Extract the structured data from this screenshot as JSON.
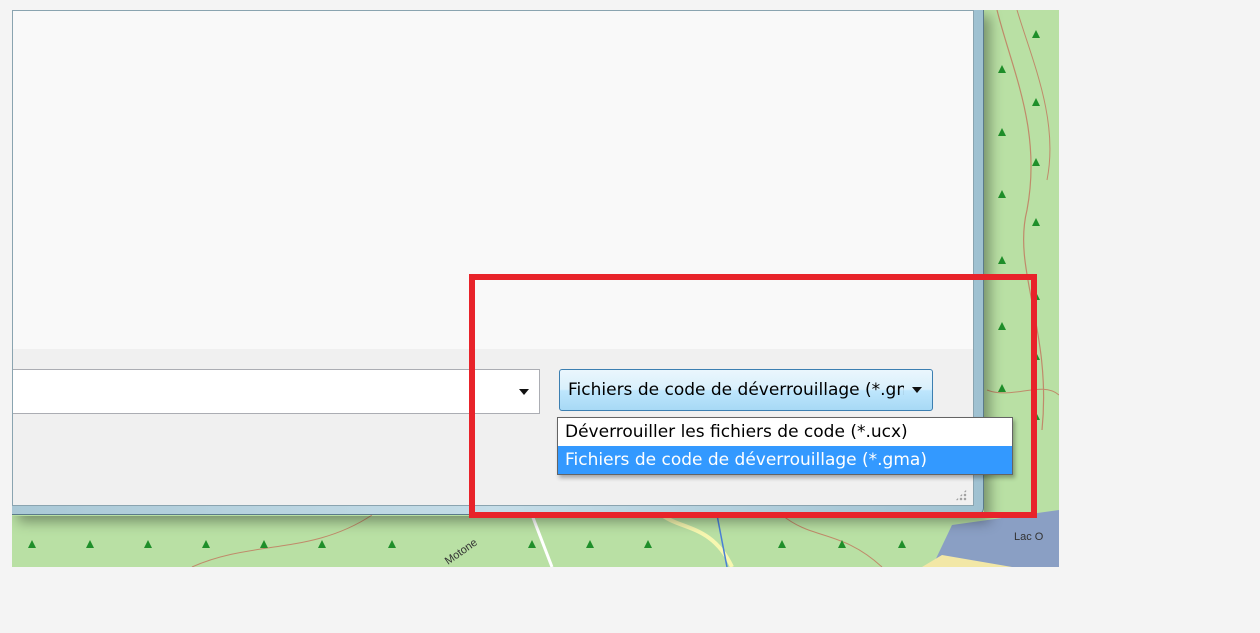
{
  "map": {
    "place_labels": [
      "Lac O",
      "Motone"
    ]
  },
  "dialog": {
    "filename_input": {
      "value": ""
    },
    "file_type_filter": {
      "selected_label": "Fichiers de code de déverrouillage (*.gma)",
      "options": [
        {
          "label": "Déverrouiller les fichiers de code (*.ucx)",
          "selected": false
        },
        {
          "label": "Fichiers de code de déverrouillage (*.gma)",
          "selected": true
        }
      ]
    }
  },
  "colors": {
    "annotation_border": "#e8232a",
    "selection_highlight": "#3399ff",
    "map_green": "#b9e0a4",
    "lake_blue": "#8a9fc4"
  }
}
